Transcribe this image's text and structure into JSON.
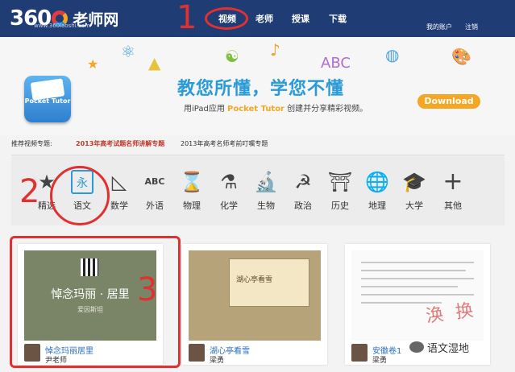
{
  "header": {
    "logo_num": "360",
    "logo_name": "老师网",
    "logo_url": "www.360laoshi.com",
    "nav": [
      "视频",
      "老师",
      "授课",
      "下载"
    ],
    "my_account": "我的账户",
    "logout": "注销"
  },
  "annotations": [
    "1",
    "2",
    "3"
  ],
  "banner": {
    "app_icon_label": "Pocket Tutor",
    "tagline": "教您所懂，学您不懂",
    "sub_prefix": "用iPad应用 ",
    "sub_app": "Pocket Tutor",
    "sub_suffix": " 创建并分享精彩视频。",
    "download": "Download",
    "deco_text": "ABC"
  },
  "recommend": {
    "label": "推荐视频专题:",
    "links": [
      "2013年高考试题名师讲解专题",
      "2013年高考名师考前叮嘱专题"
    ]
  },
  "subjects": [
    {
      "name": "精选",
      "icon": "star-icon",
      "glyph": "★"
    },
    {
      "name": "语文",
      "icon": "chinese-icon",
      "glyph": "永"
    },
    {
      "name": "数学",
      "icon": "triangle-ruler-icon",
      "glyph": "◺"
    },
    {
      "name": "外语",
      "icon": "abc-calendar-icon",
      "glyph": "ABC"
    },
    {
      "name": "物理",
      "icon": "hourglass-icon",
      "glyph": "⌛"
    },
    {
      "name": "化学",
      "icon": "flask-icon",
      "glyph": "⚗"
    },
    {
      "name": "生物",
      "icon": "microscope-icon",
      "glyph": "🔬"
    },
    {
      "name": "政治",
      "icon": "hammer-sickle-icon",
      "glyph": "☭"
    },
    {
      "name": "历史",
      "icon": "gate-icon",
      "glyph": "⛩"
    },
    {
      "name": "地理",
      "icon": "globe-icon",
      "glyph": "🌐"
    },
    {
      "name": "大学",
      "icon": "graduation-cap-icon",
      "glyph": "🎓"
    },
    {
      "name": "其他",
      "icon": "plus-icon",
      "glyph": "+"
    }
  ],
  "cards": [
    {
      "title": "悼念玛丽居里",
      "author": "尹老师",
      "thumb_big": "悼念玛丽 · 居里",
      "thumb_small": "爱因斯坦"
    },
    {
      "title": "湖心亭看雪",
      "author": "梁勇",
      "thumb_text": "湖心亭看雪"
    },
    {
      "title": "安徽卷1",
      "author": "梁勇"
    }
  ],
  "stamp": "涣 换",
  "watermark": "语文湿地"
}
